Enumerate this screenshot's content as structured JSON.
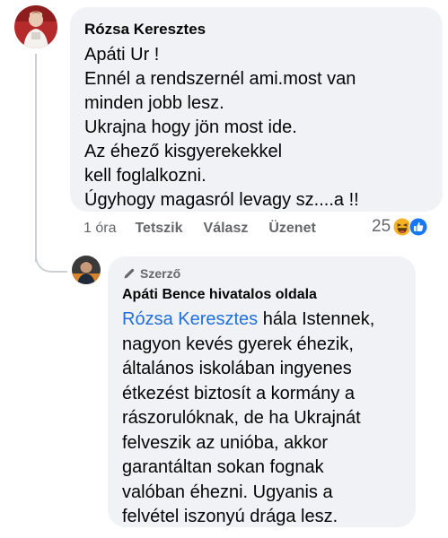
{
  "comment": {
    "author": "Rózsa Keresztes",
    "text": "Apáti Ur !\nEnnél a rendszernél ami.most van\nminden jobb lesz.\nUkrajna hogy jön most ide.\nAz éhező kisgyerekekkel\nkell foglalkozni.\nÚgyhogy magasról levagy  sz....a !!",
    "time": "1 óra",
    "actions": {
      "like": "Tetszik",
      "reply": "Válasz",
      "message": "Üzenet"
    },
    "reaction_count": "25",
    "reaction_icons": [
      "haha-icon",
      "like-icon"
    ]
  },
  "reply": {
    "badge": "Szerző",
    "author": "Apáti Bence hivatalos oldala",
    "mention": "Rózsa Keresztes",
    "text": " hála Istennek,\nnagyon kevés gyerek éhezik,\náltalános iskolában ingyenes\nétkezést biztosít a kormány a\nrászorulóknak, de ha Ukrajnát\nfelveszik az  unióba, akkor\ngarantáltan sokan fognak\nvalóban éhezni. Ugyanis a\nfelvétel iszonyú drága lesz."
  },
  "colors": {
    "bubble": "#f0f2f5",
    "secondary_text": "#65676b",
    "mention": "#216fdb",
    "like_blue": "#1877f2",
    "haha_yellow": "#f7b125"
  }
}
